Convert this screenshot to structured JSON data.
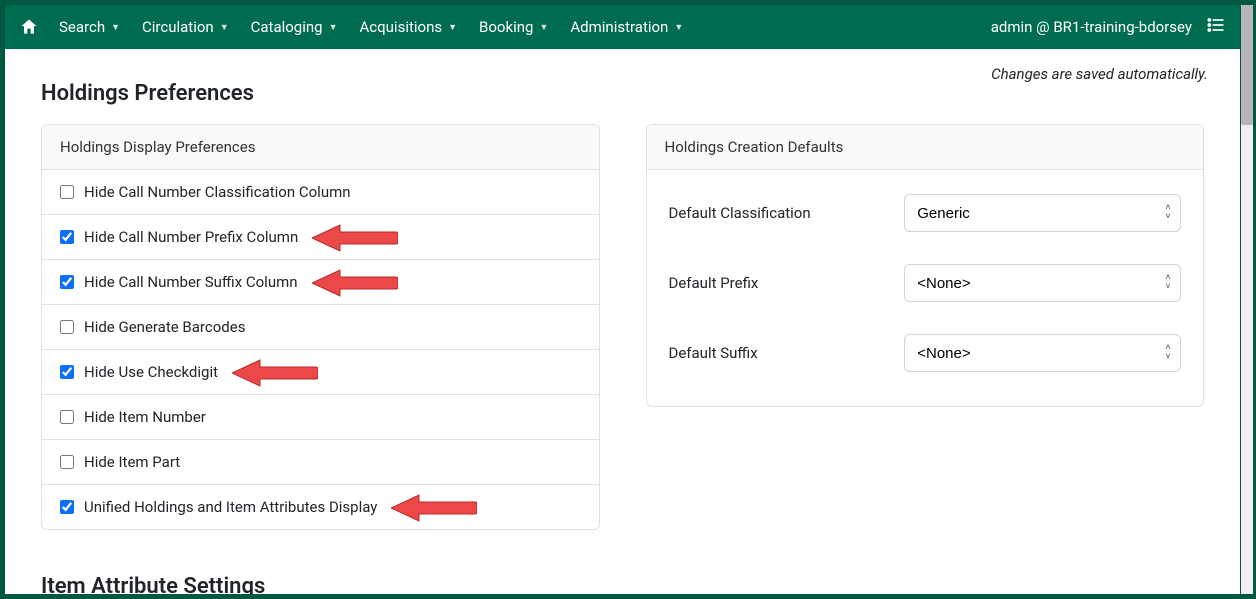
{
  "nav": {
    "items": [
      "Search",
      "Circulation",
      "Cataloging",
      "Acquisitions",
      "Booking",
      "Administration"
    ],
    "user": "admin @ BR1-training-bdorsey"
  },
  "autosave_notice": "Changes are saved automatically.",
  "page_title": "Holdings Preferences",
  "section2_title": "Item Attribute Settings",
  "display_prefs": {
    "header": "Holdings Display Preferences",
    "rows": [
      {
        "label": "Hide Call Number Classification Column",
        "checked": false,
        "arrow": false
      },
      {
        "label": "Hide Call Number Prefix Column",
        "checked": true,
        "arrow": true
      },
      {
        "label": "Hide Call Number Suffix Column",
        "checked": true,
        "arrow": true
      },
      {
        "label": "Hide Generate Barcodes",
        "checked": false,
        "arrow": false
      },
      {
        "label": "Hide Use Checkdigit",
        "checked": true,
        "arrow": true
      },
      {
        "label": "Hide Item Number",
        "checked": false,
        "arrow": false
      },
      {
        "label": "Hide Item Part",
        "checked": false,
        "arrow": false
      },
      {
        "label": "Unified Holdings and Item Attributes Display",
        "checked": true,
        "arrow": true
      }
    ]
  },
  "creation_defaults": {
    "header": "Holdings Creation Defaults",
    "rows": [
      {
        "label": "Default Classification",
        "value": "Generic"
      },
      {
        "label": "Default Prefix",
        "value": "<None>"
      },
      {
        "label": "Default Suffix",
        "value": "<None>"
      }
    ]
  }
}
